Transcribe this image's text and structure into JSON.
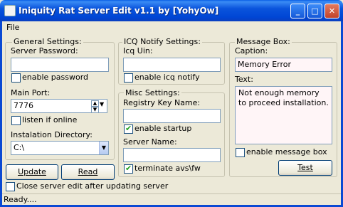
{
  "window": {
    "title": "Iniquity Rat Server Edit v1.1 by [YohyOw]"
  },
  "menu": {
    "file": "File"
  },
  "general": {
    "legend": "General Settings:",
    "server_password_label": "Server Password:",
    "server_password_value": "",
    "enable_password_label": "enable password",
    "main_port_label": "Main Port:",
    "main_port_value": "7776",
    "listen_if_online_label": "listen if online",
    "install_dir_label": "Instalation Directory:",
    "install_dir_value": "C:\\"
  },
  "icq": {
    "legend": "ICQ Notify Settings:",
    "uin_label": "Icq Uin:",
    "uin_value": "",
    "enable_icq_label": "enable icq notify"
  },
  "misc": {
    "legend": "Misc Settings:",
    "registry_key_label": "Registry Key Name:",
    "registry_key_value": "",
    "enable_startup_label": "enable startup",
    "server_name_label": "Server Name:",
    "server_name_value": "",
    "terminate_avs_label": "terminate avs\\fw"
  },
  "message": {
    "legend": "Message Box:",
    "caption_label": "Caption:",
    "caption_value": "Memory Error",
    "text_label": "Text:",
    "text_value": "Not enough memory to proceed installation.",
    "enable_msgbox_label": "enable message box",
    "test_button": "Test"
  },
  "buttons": {
    "update": "Update",
    "read": "Read"
  },
  "close_after_update_label": "Close server edit after updating server",
  "status": "Ready...."
}
